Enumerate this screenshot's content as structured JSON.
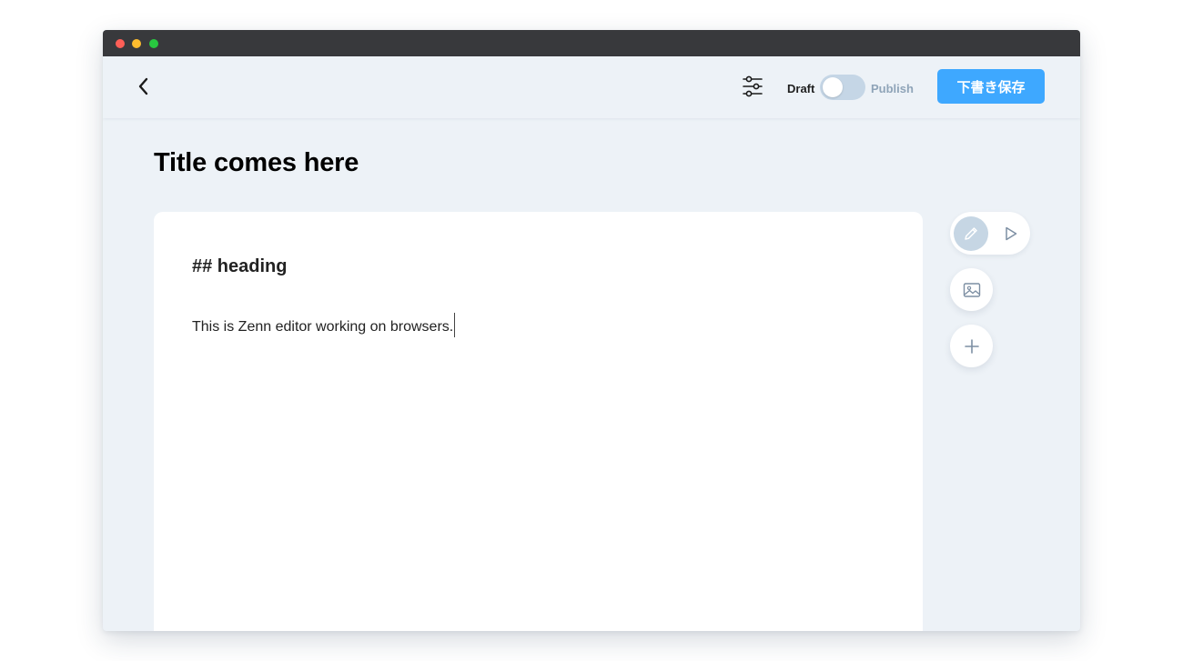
{
  "header": {
    "back_icon": "chevron-left-icon",
    "settings_icon": "sliders-icon",
    "status_toggle": {
      "left_label": "Draft",
      "right_label": "Publish",
      "state": "Draft"
    },
    "save_label": "下書き保存"
  },
  "article": {
    "title": "Title comes here",
    "body": {
      "heading": "## heading",
      "text": "This is Zenn editor working on browsers."
    }
  },
  "tools": {
    "mode_edit_icon": "pencil-icon",
    "mode_preview_icon": "play-icon",
    "image_icon": "image-icon",
    "add_icon": "plus-icon",
    "active_mode": "edit"
  },
  "colors": {
    "accent": "#3ea8ff",
    "background": "#edf2f7",
    "titlebar": "#38393c",
    "toggle_track": "#c5d6e6",
    "active_mode_bg": "#c6d6e4",
    "muted_text": "#8fa4b8"
  }
}
